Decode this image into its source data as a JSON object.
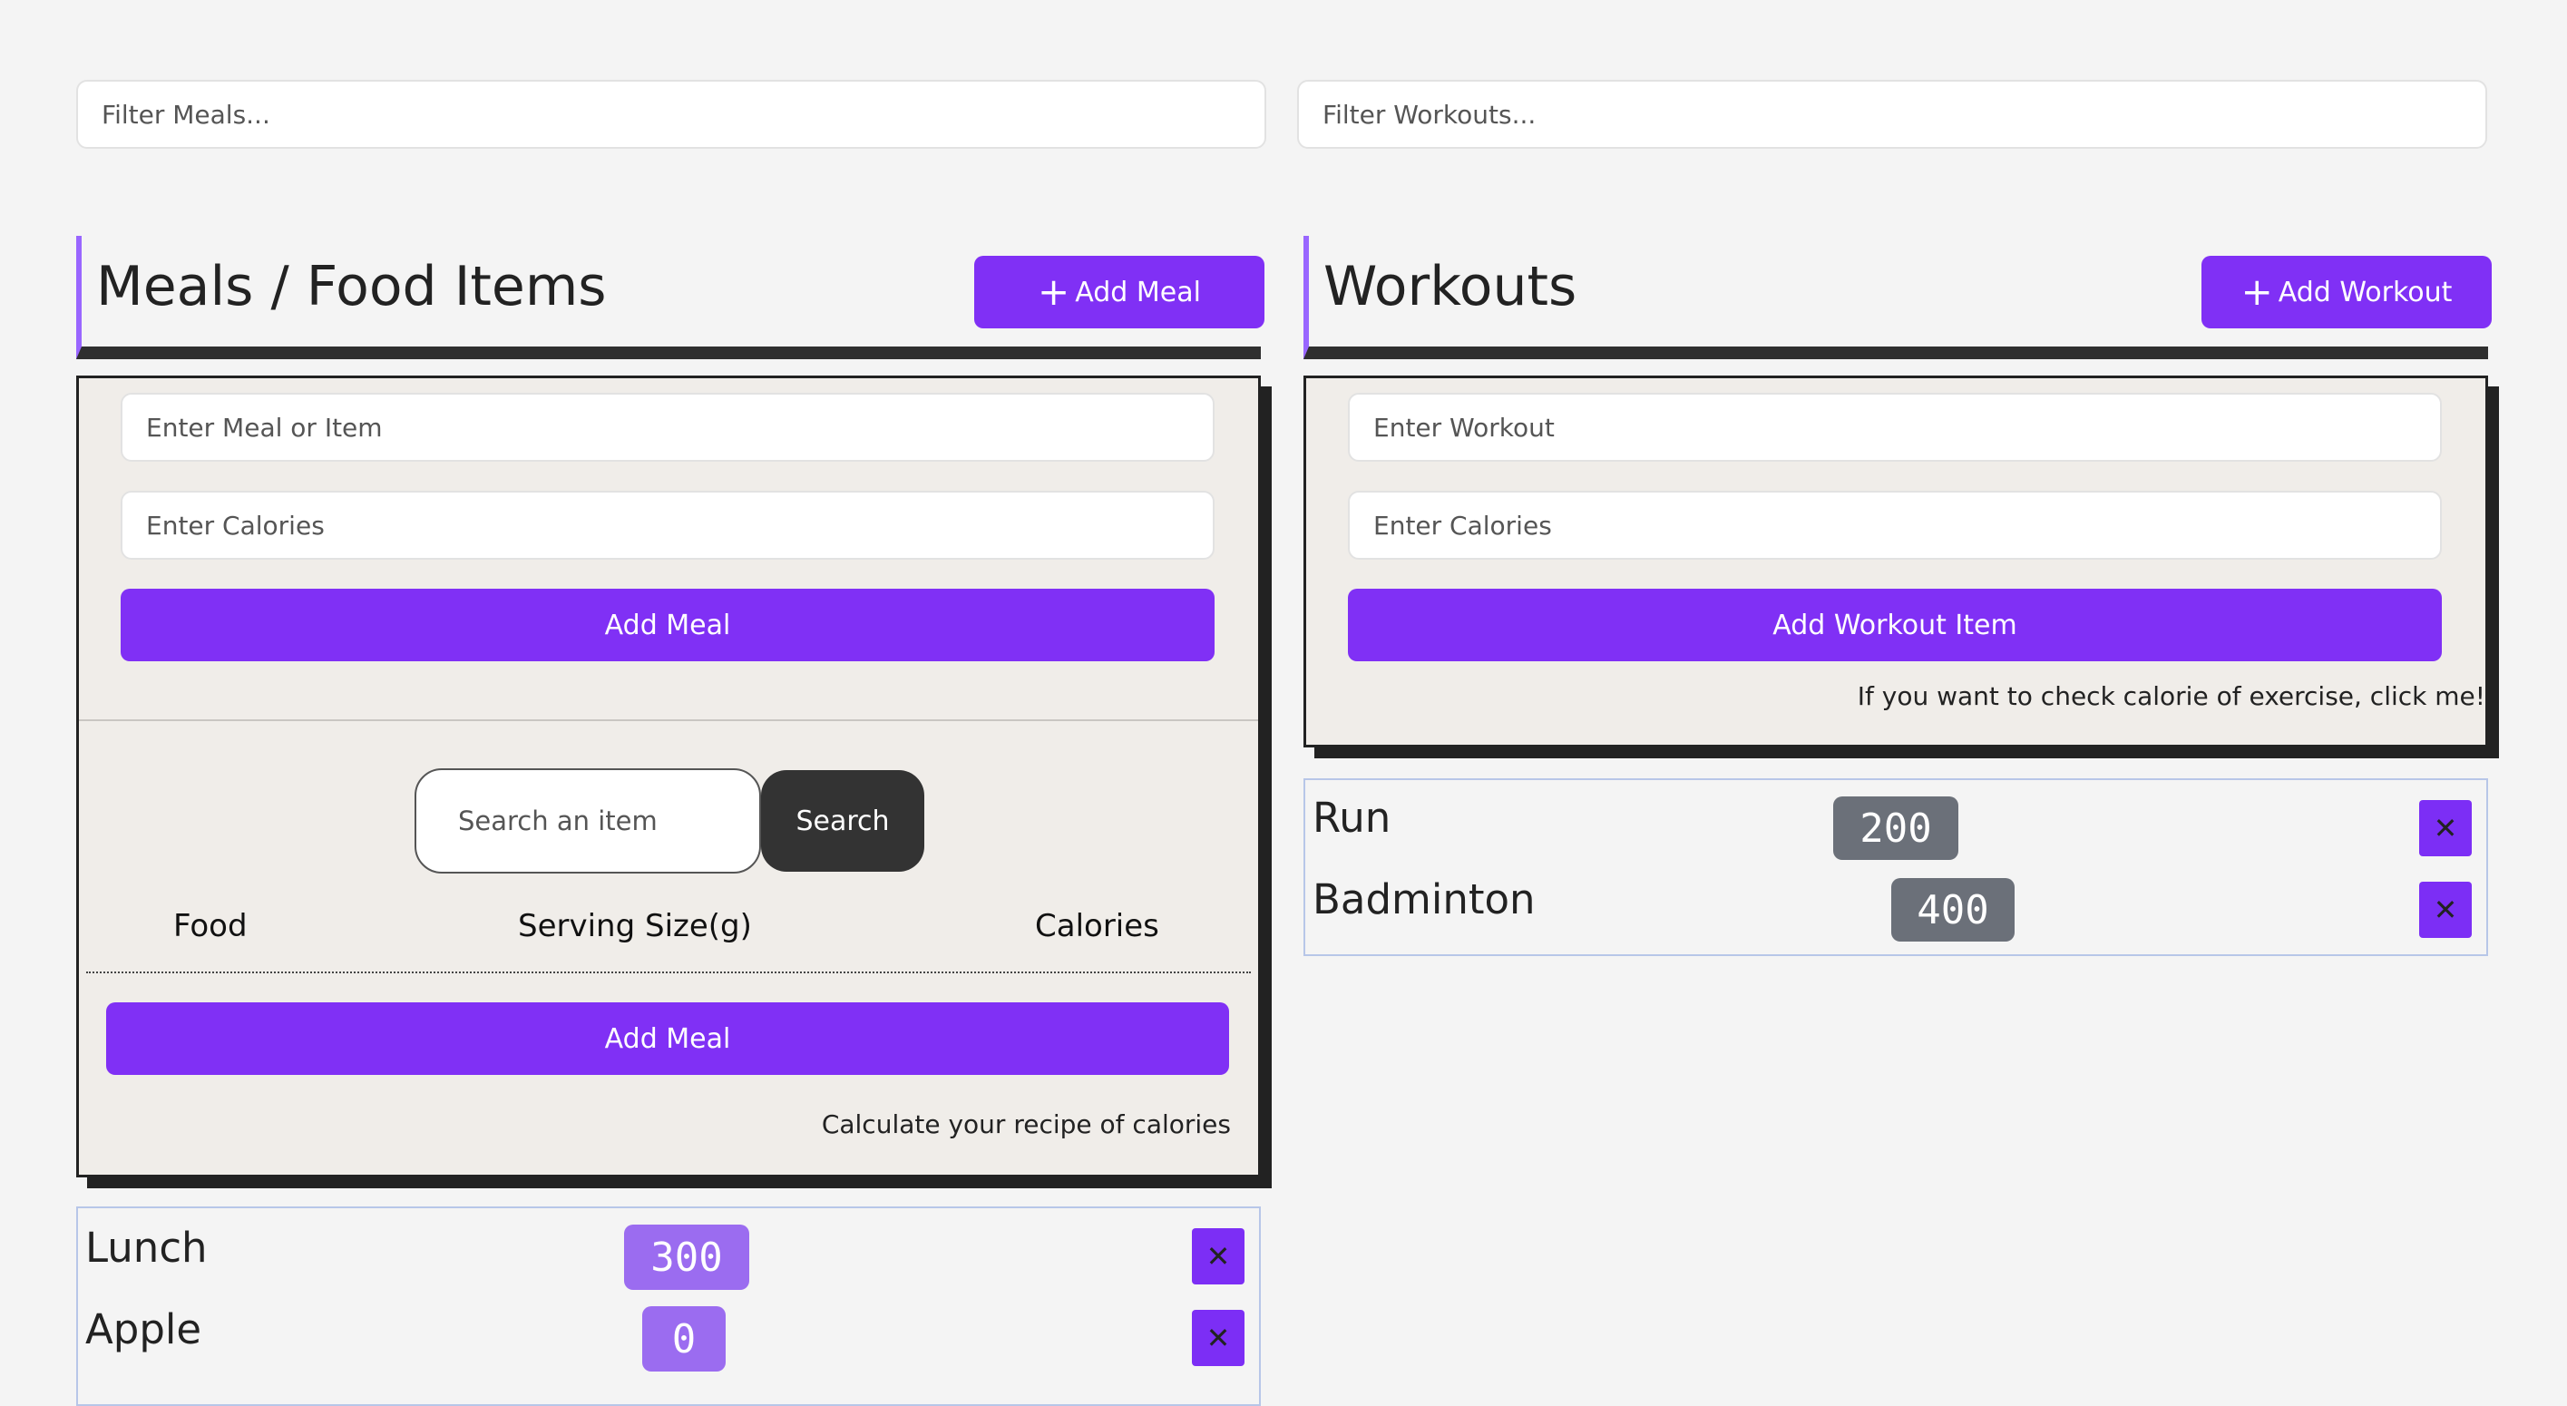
{
  "filters": {
    "meals_placeholder": "Filter Meals...",
    "workouts_placeholder": "Filter Workouts..."
  },
  "meals": {
    "title": "Meals / Food Items",
    "add_button_label": "Add Meal",
    "plus_icon": "+",
    "form": {
      "item_placeholder": "Enter Meal or Item",
      "calories_placeholder": "Enter Calories",
      "submit_label": "Add Meal"
    },
    "search": {
      "placeholder": "Search an item",
      "button_label": "Search"
    },
    "table": {
      "columns": [
        "Food",
        "Serving Size(g)",
        "Calories"
      ]
    },
    "recipe_add_label": "Add Meal",
    "recipe_note": "Calculate your recipe of calories",
    "items": [
      {
        "name": "Lunch",
        "calories": "300"
      },
      {
        "name": "Apple",
        "calories": "0"
      }
    ]
  },
  "workouts": {
    "title": "Workouts",
    "add_button_label": "Add Workout",
    "plus_icon": "+",
    "form": {
      "item_placeholder": "Enter Workout",
      "calories_placeholder": "Enter Calories",
      "submit_label": "Add Workout Item"
    },
    "note": "If you want to check calorie of exercise, click me!",
    "items": [
      {
        "name": "Run",
        "calories": "200"
      },
      {
        "name": "Badminton",
        "calories": "400"
      }
    ]
  },
  "delete_icon": "✕",
  "colors": {
    "accent": "#8030f5",
    "meal_badge": "#9b6cf0",
    "workout_badge": "#6b7079",
    "panel_bg": "#f0ede9",
    "dark": "#2f2f2f"
  }
}
